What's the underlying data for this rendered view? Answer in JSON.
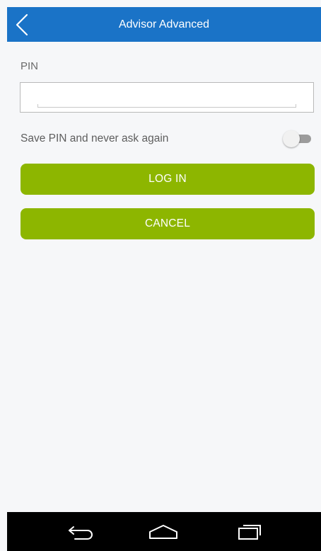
{
  "header": {
    "title": "Advisor Advanced",
    "back_icon": "chevron-left-icon"
  },
  "form": {
    "pin_label": "PIN",
    "pin_value": "",
    "pin_placeholder": "",
    "save_pin_label": "Save PIN and never ask again",
    "save_pin_enabled": false,
    "login_label": "LOG IN",
    "cancel_label": "CANCEL"
  },
  "navigation": {
    "back_icon": "back-icon",
    "home_icon": "home-icon",
    "recents_icon": "recent-apps-icon"
  },
  "colors": {
    "app_bar": "#1a73c7",
    "primary_button": "#8db600",
    "background": "#f6f7f9",
    "nav_bar": "#000000"
  }
}
